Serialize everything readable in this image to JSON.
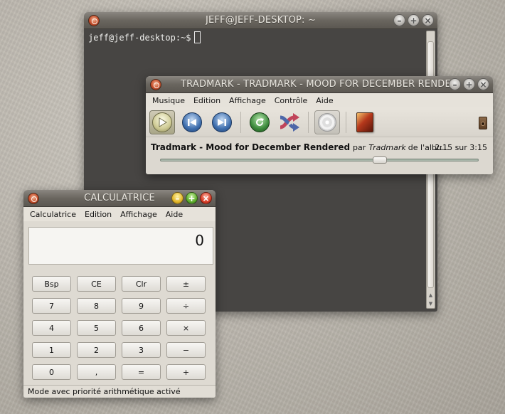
{
  "terminal": {
    "title": "JEFF@JEFF-DESKTOP: ~",
    "prompt": "jeff@jeff-desktop:~$"
  },
  "player": {
    "title": "TRADMARK - TRADMARK - MOOD FOR DECEMBER RENDERED",
    "menu": [
      "Musique",
      "Edition",
      "Affichage",
      "Contrôle",
      "Aide"
    ],
    "toolbar_icons": [
      "play-icon",
      "previous-icon",
      "next-icon",
      "repeat-icon",
      "shuffle-icon",
      "visualizer-icon",
      "album-cover-icon",
      "speaker-icon"
    ],
    "track_title": "Tradmark - Mood for December Rendered",
    "by": "par",
    "artist": "Tradmark",
    "of_album": "de l'albu...",
    "time": "2:15 sur 3:15",
    "progress": 0.69,
    "colors": {
      "play": "#e3e0b8",
      "prev_next": "#3f6fae",
      "repeat": "#3c8a3c",
      "shuffle": "#c0445a"
    }
  },
  "calculator": {
    "title": "CALCULATRICE",
    "menu": [
      "Calculatrice",
      "Edition",
      "Affichage",
      "Aide"
    ],
    "display": "0",
    "keys": [
      [
        "Bsp",
        "CE",
        "Clr",
        "±"
      ],
      [
        "7",
        "8",
        "9",
        "÷"
      ],
      [
        "4",
        "5",
        "6",
        "×"
      ],
      [
        "1",
        "2",
        "3",
        "−"
      ],
      [
        "0",
        ",",
        "=",
        "+"
      ]
    ],
    "status": "Mode avec priorité arithmétique activé"
  }
}
